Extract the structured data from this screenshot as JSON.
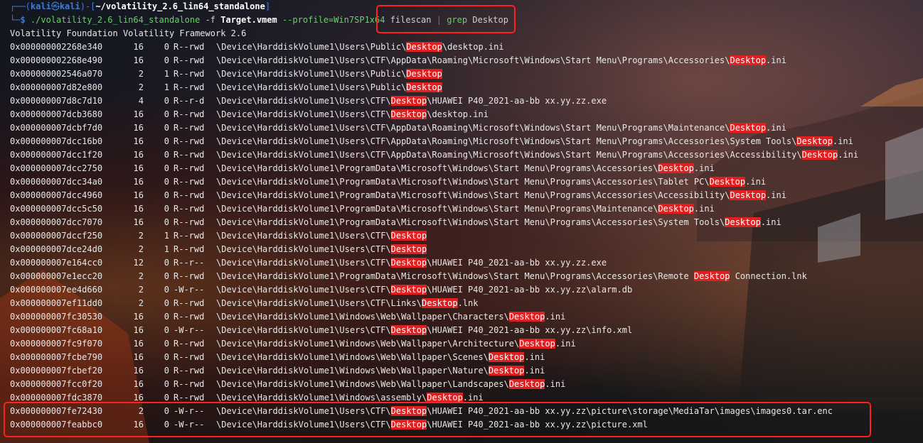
{
  "prompt": {
    "user": "kali",
    "host": "kali",
    "cwd": "~/volatility_2.6_lin64_standalone",
    "command_exe": "./volatility_2.6_lin64_standalone",
    "flag_f": "-f",
    "file": "Target.vmem",
    "profile_opt": "--profile=Win7SP1x64",
    "plugin": "filescan",
    "pipe": "|",
    "grep": "grep",
    "grep_arg": "Desktop"
  },
  "header": "Volatility Foundation Volatility Framework 2.6",
  "highlight_word": "Desktop",
  "rows": [
    {
      "offset": "0x000000002268e340",
      "ptr": "16",
      "hnd": "0",
      "access": "R--rwd",
      "pre": "\\Device\\HarddiskVolume1\\Users\\Public\\",
      "post": "\\desktop.ini"
    },
    {
      "offset": "0x000000002268e490",
      "ptr": "16",
      "hnd": "0",
      "access": "R--rwd",
      "pre": "\\Device\\HarddiskVolume1\\Users\\CTF\\AppData\\Roaming\\Microsoft\\Windows\\Start Menu\\Programs\\Accessories\\",
      "post": ".ini"
    },
    {
      "offset": "0x000000002546a070",
      "ptr": "2",
      "hnd": "1",
      "access": "R--rwd",
      "pre": "\\Device\\HarddiskVolume1\\Users\\Public\\",
      "post": ""
    },
    {
      "offset": "0x000000007d82e800",
      "ptr": "2",
      "hnd": "1",
      "access": "R--rwd",
      "pre": "\\Device\\HarddiskVolume1\\Users\\Public\\",
      "post": ""
    },
    {
      "offset": "0x000000007d8c7d10",
      "ptr": "4",
      "hnd": "0",
      "access": "R--r-d",
      "pre": "\\Device\\HarddiskVolume1\\Users\\CTF\\",
      "post": "\\HUAWEI P40_2021-aa-bb xx.yy.zz.exe"
    },
    {
      "offset": "0x000000007dcb3680",
      "ptr": "16",
      "hnd": "0",
      "access": "R--rwd",
      "pre": "\\Device\\HarddiskVolume1\\Users\\CTF\\",
      "post": "\\desktop.ini"
    },
    {
      "offset": "0x000000007dcbf7d0",
      "ptr": "16",
      "hnd": "0",
      "access": "R--rwd",
      "pre": "\\Device\\HarddiskVolume1\\Users\\CTF\\AppData\\Roaming\\Microsoft\\Windows\\Start Menu\\Programs\\Maintenance\\",
      "post": ".ini"
    },
    {
      "offset": "0x000000007dcc16b0",
      "ptr": "16",
      "hnd": "0",
      "access": "R--rwd",
      "pre": "\\Device\\HarddiskVolume1\\Users\\CTF\\AppData\\Roaming\\Microsoft\\Windows\\Start Menu\\Programs\\Accessories\\System Tools\\",
      "post": ".ini"
    },
    {
      "offset": "0x000000007dcc1f20",
      "ptr": "16",
      "hnd": "0",
      "access": "R--rwd",
      "pre": "\\Device\\HarddiskVolume1\\Users\\CTF\\AppData\\Roaming\\Microsoft\\Windows\\Start Menu\\Programs\\Accessories\\Accessibility\\",
      "post": ".ini"
    },
    {
      "offset": "0x000000007dcc2750",
      "ptr": "16",
      "hnd": "0",
      "access": "R--rwd",
      "pre": "\\Device\\HarddiskVolume1\\ProgramData\\Microsoft\\Windows\\Start Menu\\Programs\\Accessories\\",
      "post": ".ini"
    },
    {
      "offset": "0x000000007dcc34a0",
      "ptr": "16",
      "hnd": "0",
      "access": "R--rwd",
      "pre": "\\Device\\HarddiskVolume1\\ProgramData\\Microsoft\\Windows\\Start Menu\\Programs\\Accessories\\Tablet PC\\",
      "post": ".ini"
    },
    {
      "offset": "0x000000007dcc4960",
      "ptr": "16",
      "hnd": "0",
      "access": "R--rwd",
      "pre": "\\Device\\HarddiskVolume1\\ProgramData\\Microsoft\\Windows\\Start Menu\\Programs\\Accessories\\Accessibility\\",
      "post": ".ini"
    },
    {
      "offset": "0x000000007dcc5c50",
      "ptr": "16",
      "hnd": "0",
      "access": "R--rwd",
      "pre": "\\Device\\HarddiskVolume1\\ProgramData\\Microsoft\\Windows\\Start Menu\\Programs\\Maintenance\\",
      "post": ".ini"
    },
    {
      "offset": "0x000000007dcc7070",
      "ptr": "16",
      "hnd": "0",
      "access": "R--rwd",
      "pre": "\\Device\\HarddiskVolume1\\ProgramData\\Microsoft\\Windows\\Start Menu\\Programs\\Accessories\\System Tools\\",
      "post": ".ini"
    },
    {
      "offset": "0x000000007dccf250",
      "ptr": "2",
      "hnd": "1",
      "access": "R--rwd",
      "pre": "\\Device\\HarddiskVolume1\\Users\\CTF\\",
      "post": ""
    },
    {
      "offset": "0x000000007dce24d0",
      "ptr": "2",
      "hnd": "1",
      "access": "R--rwd",
      "pre": "\\Device\\HarddiskVolume1\\Users\\CTF\\",
      "post": ""
    },
    {
      "offset": "0x000000007e164cc0",
      "ptr": "12",
      "hnd": "0",
      "access": "R--r--",
      "pre": "\\Device\\HarddiskVolume1\\Users\\CTF\\",
      "post": "\\HUAWEI P40_2021-aa-bb xx.yy.zz.exe"
    },
    {
      "offset": "0x000000007e1ecc20",
      "ptr": "2",
      "hnd": "0",
      "access": "R--rwd",
      "pre": "\\Device\\HarddiskVolume1\\ProgramData\\Microsoft\\Windows\\Start Menu\\Programs\\Accessories\\Remote ",
      "post": " Connection.lnk"
    },
    {
      "offset": "0x000000007ee4d660",
      "ptr": "2",
      "hnd": "0",
      "access": "-W-r--",
      "pre": "\\Device\\HarddiskVolume1\\Users\\CTF\\",
      "post": "\\HUAWEI P40_2021-aa-bb xx.yy.zz\\alarm.db"
    },
    {
      "offset": "0x000000007ef11dd0",
      "ptr": "2",
      "hnd": "0",
      "access": "R--rwd",
      "pre": "\\Device\\HarddiskVolume1\\Users\\CTF\\Links\\",
      "post": ".lnk"
    },
    {
      "offset": "0x000000007fc30530",
      "ptr": "16",
      "hnd": "0",
      "access": "R--rwd",
      "pre": "\\Device\\HarddiskVolume1\\Windows\\Web\\Wallpaper\\Characters\\",
      "post": ".ini"
    },
    {
      "offset": "0x000000007fc68a10",
      "ptr": "16",
      "hnd": "0",
      "access": "-W-r--",
      "pre": "\\Device\\HarddiskVolume1\\Users\\CTF\\",
      "post": "\\HUAWEI P40_2021-aa-bb xx.yy.zz\\info.xml"
    },
    {
      "offset": "0x000000007fc9f070",
      "ptr": "16",
      "hnd": "0",
      "access": "R--rwd",
      "pre": "\\Device\\HarddiskVolume1\\Windows\\Web\\Wallpaper\\Architecture\\",
      "post": ".ini"
    },
    {
      "offset": "0x000000007fcbe790",
      "ptr": "16",
      "hnd": "0",
      "access": "R--rwd",
      "pre": "\\Device\\HarddiskVolume1\\Windows\\Web\\Wallpaper\\Scenes\\",
      "post": ".ini"
    },
    {
      "offset": "0x000000007fcbef20",
      "ptr": "16",
      "hnd": "0",
      "access": "R--rwd",
      "pre": "\\Device\\HarddiskVolume1\\Windows\\Web\\Wallpaper\\Nature\\",
      "post": ".ini"
    },
    {
      "offset": "0x000000007fcc0f20",
      "ptr": "16",
      "hnd": "0",
      "access": "R--rwd",
      "pre": "\\Device\\HarddiskVolume1\\Windows\\Web\\Wallpaper\\Landscapes\\",
      "post": ".ini"
    },
    {
      "offset": "0x000000007fdc3870",
      "ptr": "16",
      "hnd": "0",
      "access": "R--rwd",
      "pre": "\\Device\\HarddiskVolume1\\Windows\\assembly\\",
      "post": ".ini"
    },
    {
      "offset": "0x000000007fe72430",
      "ptr": "2",
      "hnd": "0",
      "access": "-W-r--",
      "pre": "\\Device\\HarddiskVolume1\\Users\\CTF\\",
      "post": "\\HUAWEI P40_2021-aa-bb xx.yy.zz\\picture\\storage\\MediaTar\\images\\images0.tar.enc"
    },
    {
      "offset": "0x000000007feabbc0",
      "ptr": "16",
      "hnd": "0",
      "access": "-W-r--",
      "pre": "\\Device\\HarddiskVolume1\\Users\\CTF\\",
      "post": "\\HUAWEI P40_2021-aa-bb xx.yy.zz\\picture.xml"
    }
  ],
  "colors": {
    "highlight_bg": "#e02020",
    "annotation_box": "#ff2020",
    "prompt_blue": "#3f7cd8",
    "command_green": "#5fd75f"
  }
}
